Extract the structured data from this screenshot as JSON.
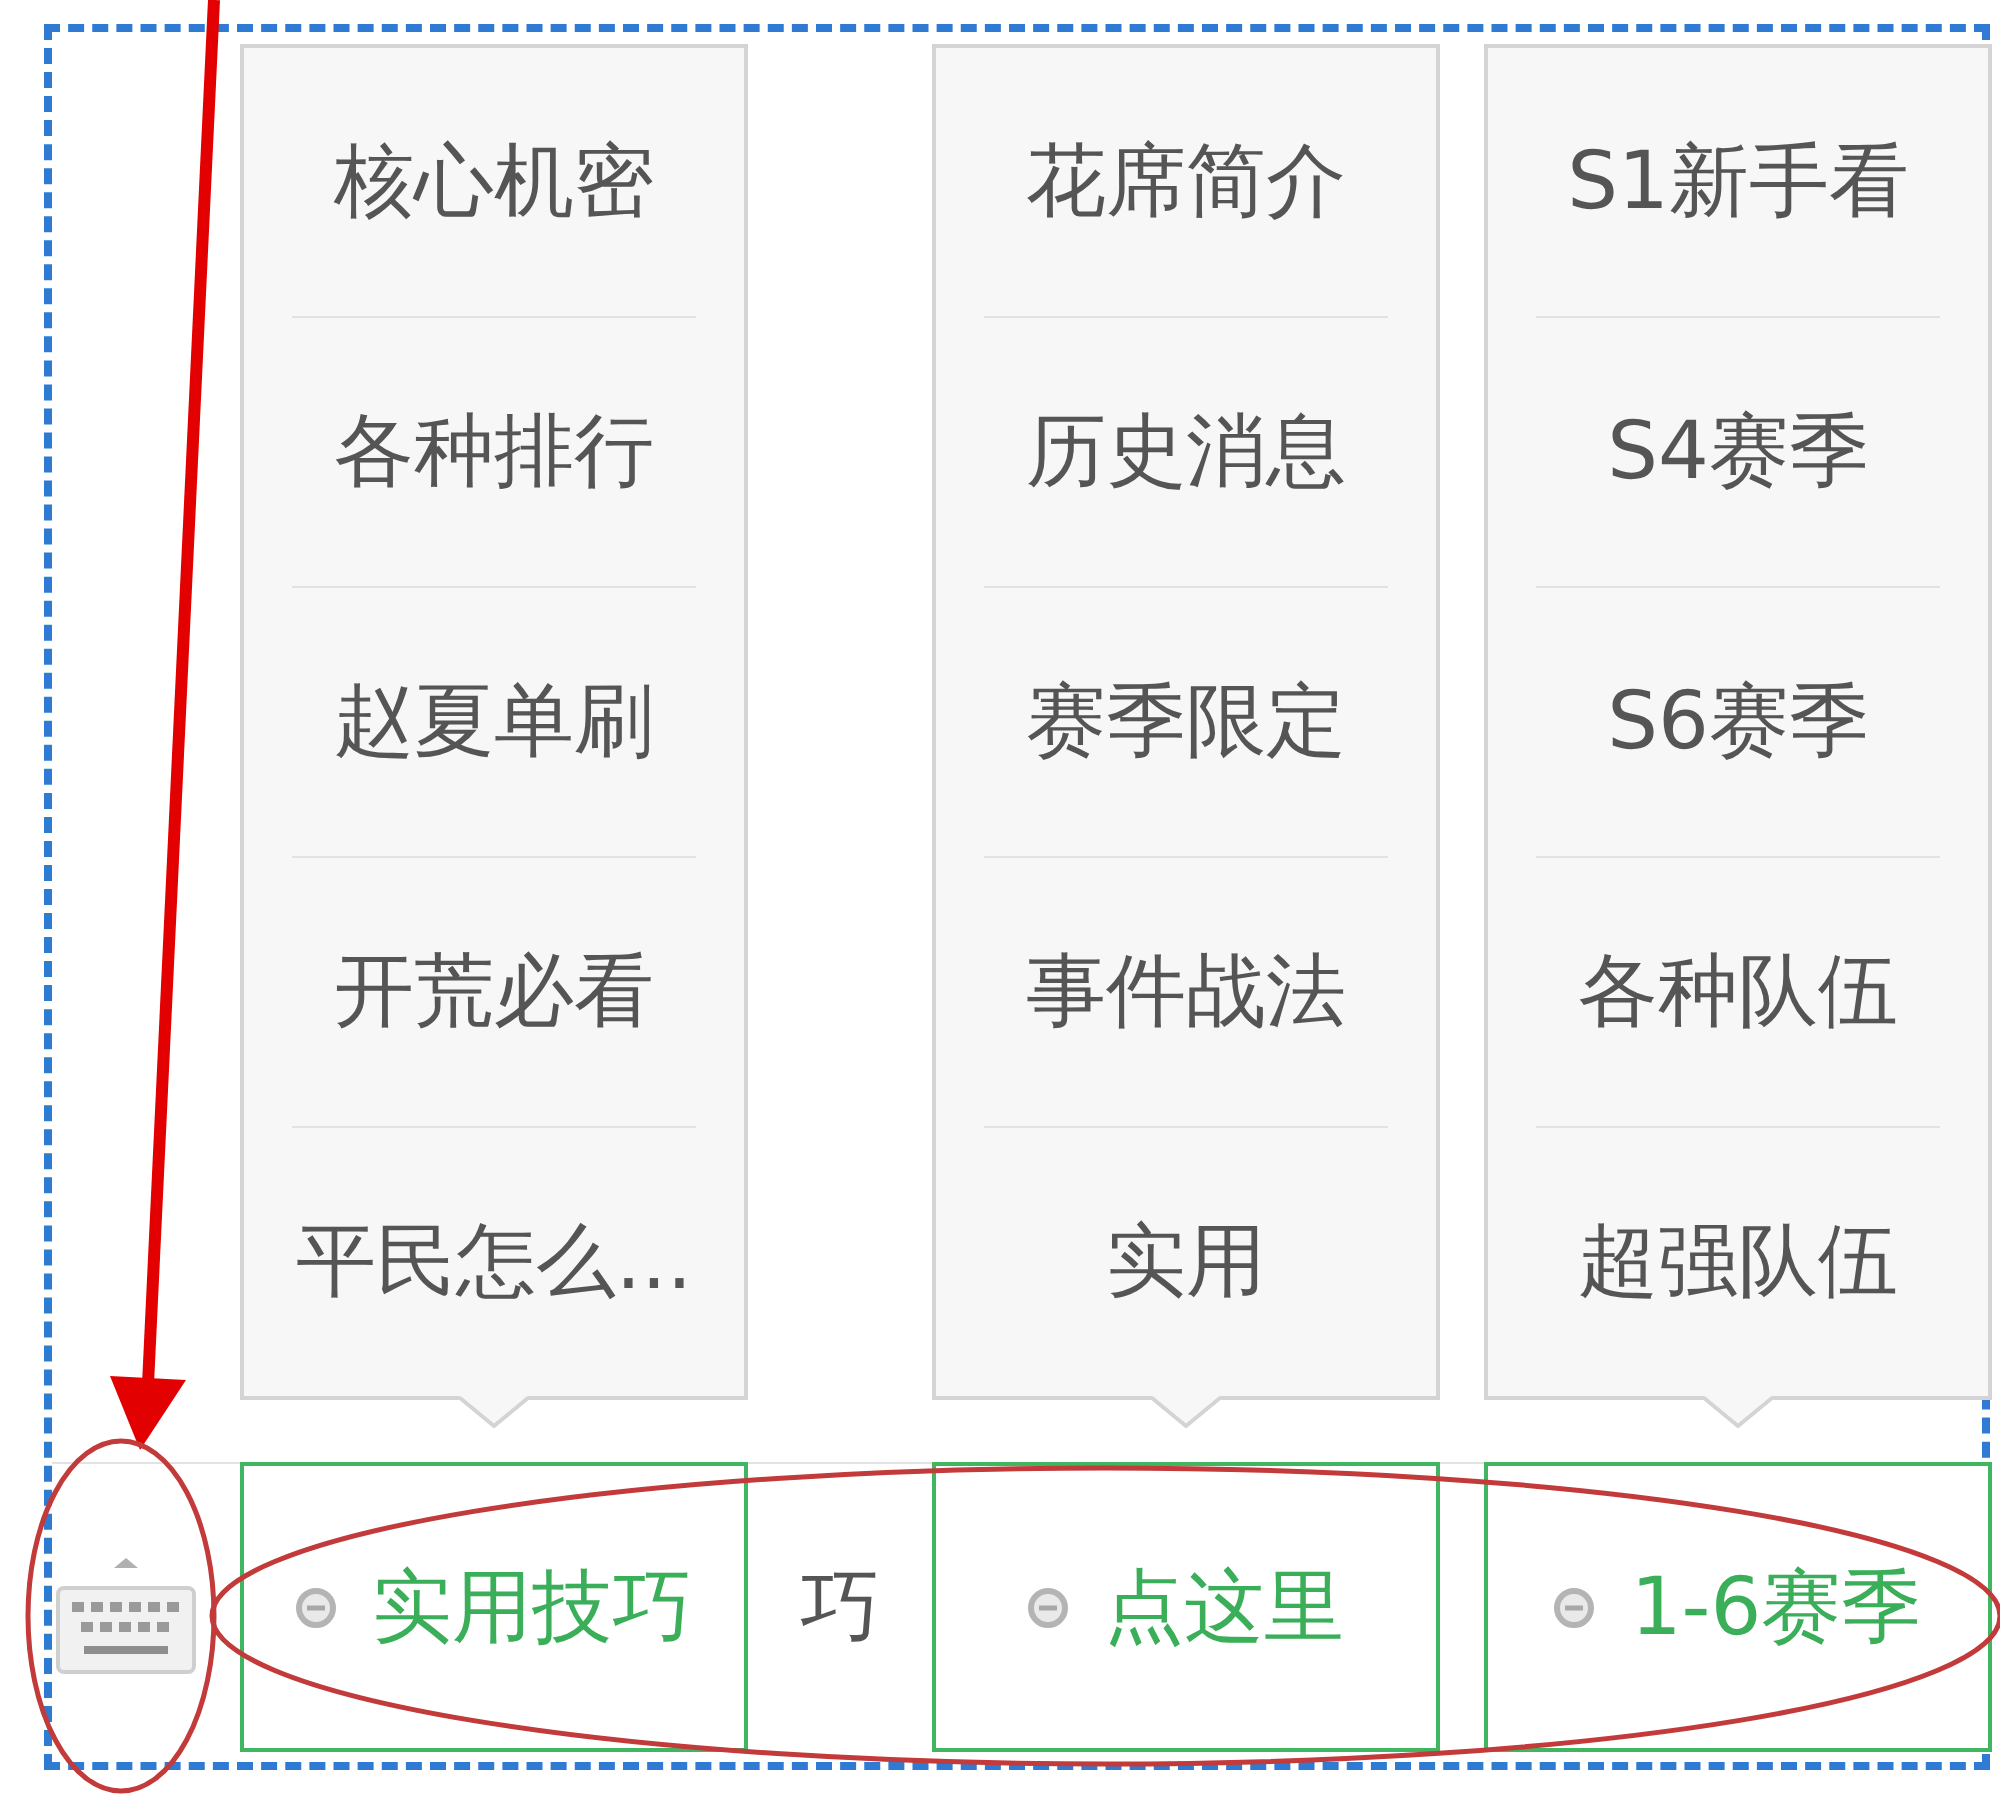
{
  "menu_bar": {
    "items": [
      {
        "kind": "button",
        "label": "实用技巧",
        "selected": true,
        "submenu": [
          "核心机密",
          "各种排行",
          "赵夏单刷",
          "开荒必看",
          "平民怎么..."
        ]
      },
      {
        "kind": "fragment",
        "label": "巧"
      },
      {
        "kind": "button",
        "label": "点这里",
        "selected": true,
        "submenu": [
          "花席简介",
          "历史消息",
          "赛季限定",
          "事件战法",
          "实用"
        ]
      },
      {
        "kind": "button",
        "label": "1-6赛季",
        "selected": true,
        "submenu": [
          "S1新手看",
          "S4赛季",
          "S6赛季",
          "各种队伍",
          "超强队伍"
        ]
      }
    ]
  }
}
